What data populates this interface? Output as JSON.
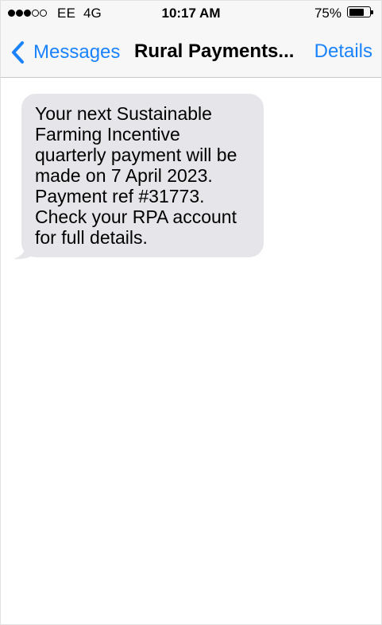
{
  "status_bar": {
    "signal_bars": 5,
    "signal_full": 3,
    "carrier": "EE",
    "network": "4G",
    "time": "10:17 AM",
    "battery_percent": "75%",
    "battery_level": 0.75
  },
  "nav": {
    "back_icon": "chevron-left-icon",
    "back_label": "Messages",
    "title": "Rural Payments...",
    "details_label": "Details",
    "accent_color": "#1a82fb"
  },
  "messages": [
    {
      "direction": "incoming",
      "text": "Your next Sustainable\nFarming Incentive\nquarterly payment will be\nmade on 7 April 2023.\nPayment ref #31773.\nCheck your RPA account\nfor full details.",
      "bubble_color": "#e5e5ea"
    }
  ]
}
